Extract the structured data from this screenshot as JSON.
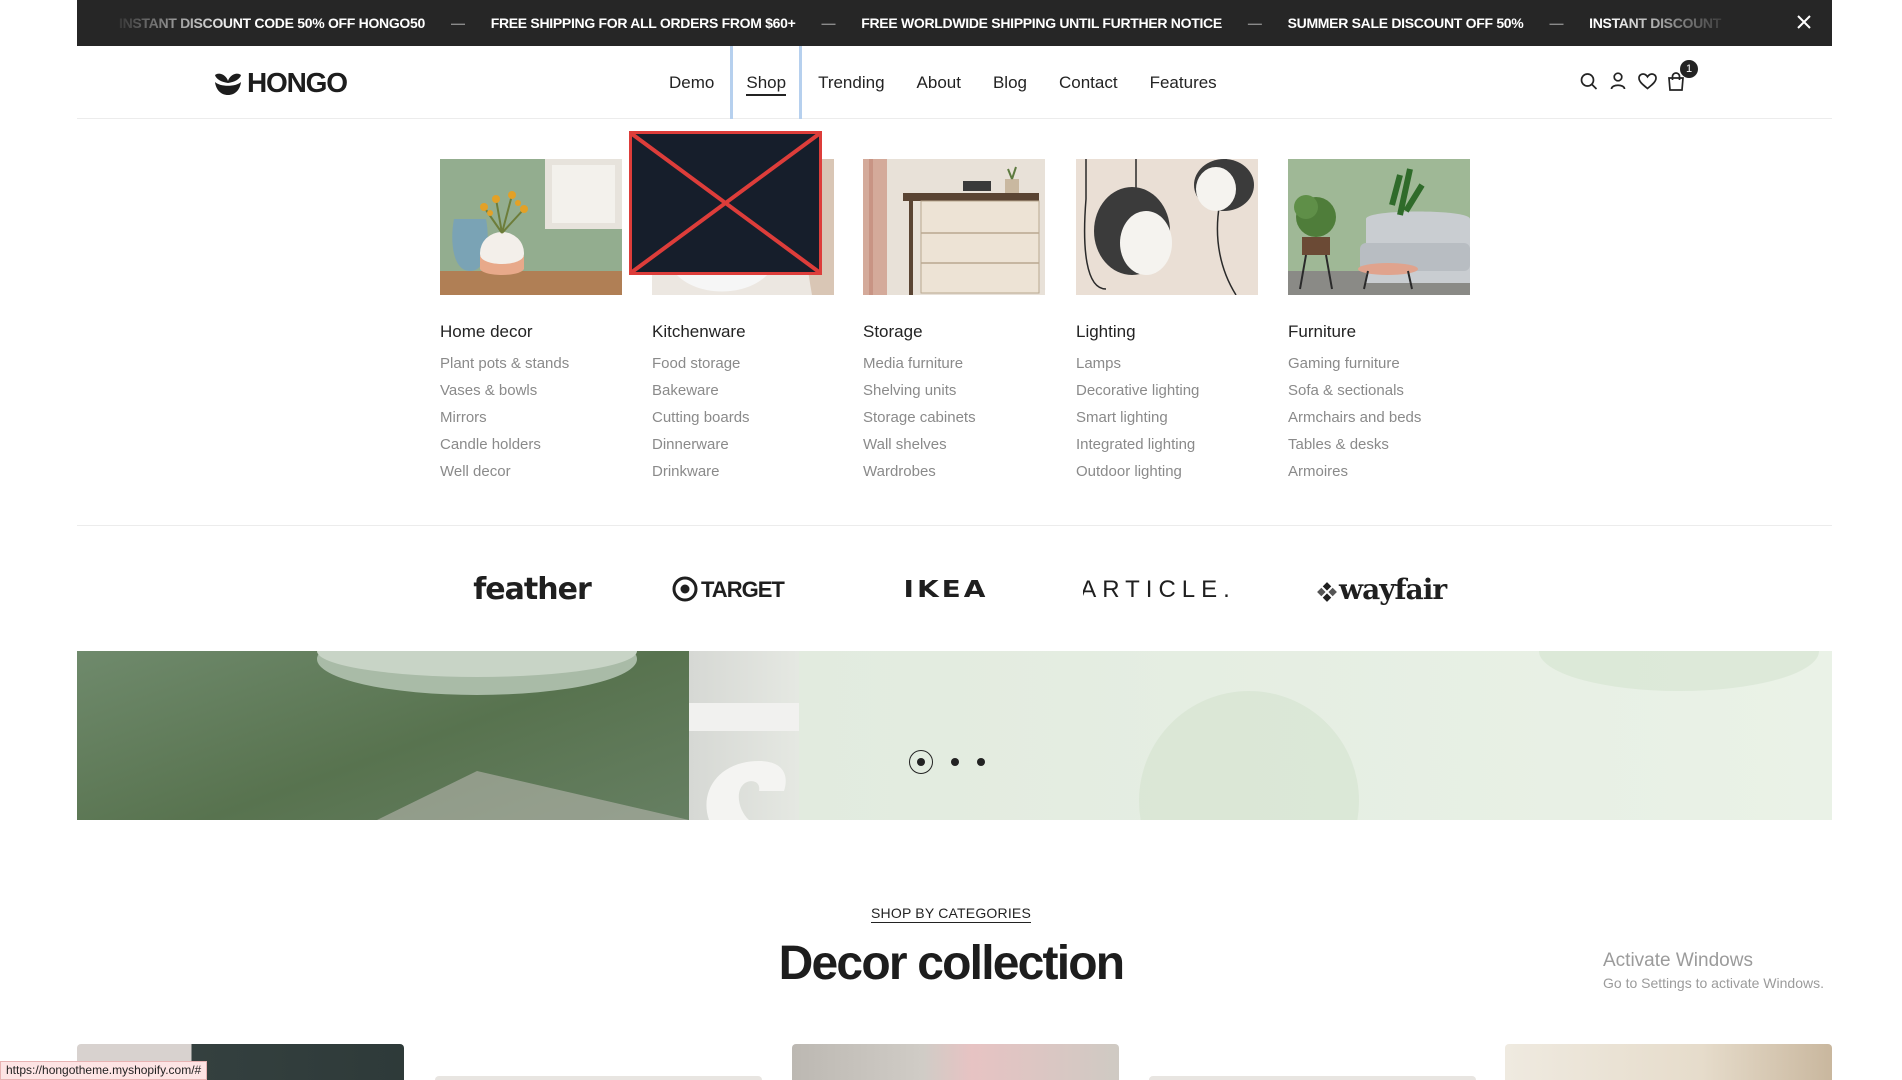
{
  "announcement": {
    "items": [
      "INSTANT DISCOUNT CODE 50% OFF HONGO50",
      "FREE SHIPPING FOR ALL ORDERS FROM $60+",
      "FREE WORLDWIDE SHIPPING UNTIL FURTHER NOTICE",
      "SUMMER SALE DISCOUNT OFF 50%",
      "INSTANT DISCOUNT"
    ],
    "separator": "—",
    "close_icon": "close-icon"
  },
  "header": {
    "logo_text": "HONGO",
    "nav": [
      "Demo",
      "Shop",
      "Trending",
      "About",
      "Blog",
      "Contact",
      "Features"
    ],
    "active_nav": "Shop",
    "icons": [
      "search-icon",
      "user-icon",
      "heart-icon",
      "cart-icon"
    ],
    "cart_count": "1"
  },
  "mega_menu": {
    "columns": [
      {
        "title": "Home decor",
        "links": [
          "Plant pots & stands",
          "Vases & bowls",
          "Mirrors",
          "Candle holders",
          "Well decor"
        ]
      },
      {
        "title": "Kitchenware",
        "links": [
          "Food storage",
          "Bakeware",
          "Cutting boards",
          "Dinnerware",
          "Drinkware"
        ]
      },
      {
        "title": "Storage",
        "links": [
          "Media furniture",
          "Shelving units",
          "Storage cabinets",
          "Wall shelves",
          "Wardrobes"
        ]
      },
      {
        "title": "Lighting",
        "links": [
          "Lamps",
          "Decorative lighting",
          "Smart lighting",
          "Integrated lighting",
          "Outdoor lighting"
        ]
      },
      {
        "title": "Furniture",
        "links": [
          "Gaming furniture",
          "Sofa & sectionals",
          "Armchairs and beds",
          "Tables & desks",
          "Armoires"
        ]
      }
    ],
    "brands": [
      "feather",
      "TARGET",
      "IKEA",
      "ARTICLE.",
      "wayfair"
    ]
  },
  "hero": {
    "slide_count": 3,
    "active_slide": 1
  },
  "categories_section": {
    "eyebrow": "SHOP BY CATEGORIES",
    "title": "Decor collection"
  },
  "overlay": {
    "activate_title": "Activate Windows",
    "activate_sub": "Go to Settings to activate Windows.",
    "status_url": "https://hongotheme.myshopify.com/#"
  },
  "colors": {
    "announcement_bg": "#262626",
    "text_dark": "#232323",
    "link_gray": "#8a8a8a",
    "hero_green": "#58734f",
    "hero_light": "#e5eee3",
    "broken_image_red": "#dd3d3a"
  }
}
